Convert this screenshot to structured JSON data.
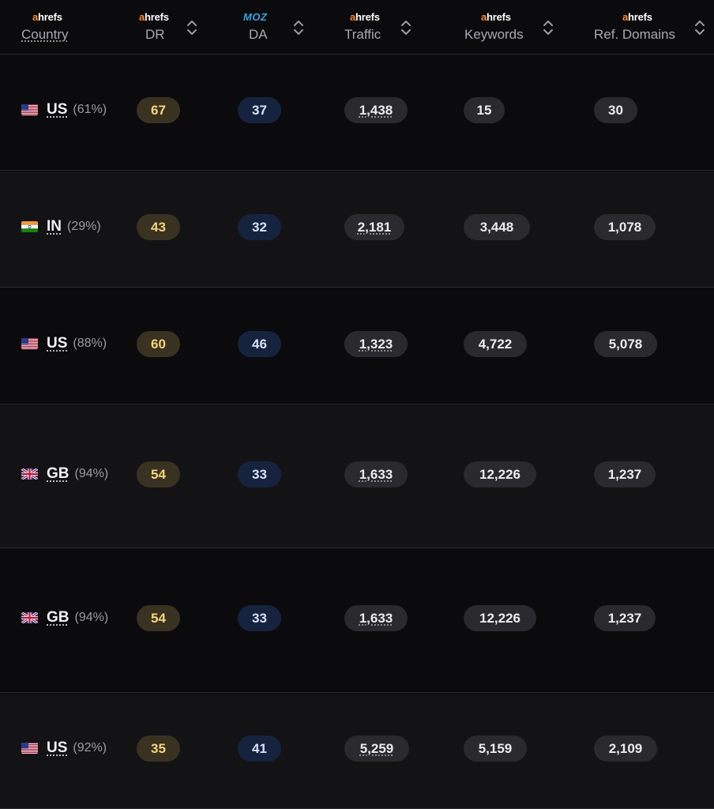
{
  "header": {
    "country": {
      "brand": "ahrefs",
      "label": "Country"
    },
    "dr": {
      "brand": "ahrefs",
      "label": "DR"
    },
    "da": {
      "brand": "MOZ",
      "label": "DA"
    },
    "traffic": {
      "brand": "ahrefs",
      "label": "Traffic"
    },
    "keywords": {
      "brand": "ahrefs",
      "label": "Keywords"
    },
    "ref_domains": {
      "brand": "ahrefs",
      "label": "Ref. Domains"
    }
  },
  "colors": {
    "ahrefs_accent": "#ff8a1f",
    "moz_blue": "#2aa7e0",
    "dr_pill": "#3a3220",
    "da_pill": "#16233f",
    "value_pill": "#2a2a2e"
  },
  "rows": [
    {
      "country": "US",
      "flag": "us-flag-icon",
      "pct": "(61%)",
      "dr": "67",
      "da": "37",
      "traffic": "1,438",
      "keywords": "15",
      "ref_domains": "30"
    },
    {
      "country": "IN",
      "flag": "in-flag-icon",
      "pct": "(29%)",
      "dr": "43",
      "da": "32",
      "traffic": "2,181",
      "keywords": "3,448",
      "ref_domains": "1,078"
    },
    {
      "country": "US",
      "flag": "us-flag-icon",
      "pct": "(88%)",
      "dr": "60",
      "da": "46",
      "traffic": "1,323",
      "keywords": "4,722",
      "ref_domains": "5,078"
    },
    {
      "country": "GB",
      "flag": "gb-flag-icon",
      "pct": "(94%)",
      "dr": "54",
      "da": "33",
      "traffic": "1,633",
      "keywords": "12,226",
      "ref_domains": "1,237"
    },
    {
      "country": "GB",
      "flag": "gb-flag-icon",
      "pct": "(94%)",
      "dr": "54",
      "da": "33",
      "traffic": "1,633",
      "keywords": "12,226",
      "ref_domains": "1,237"
    },
    {
      "country": "US",
      "flag": "us-flag-icon",
      "pct": "(92%)",
      "dr": "35",
      "da": "41",
      "traffic": "5,259",
      "keywords": "5,159",
      "ref_domains": "2,109"
    }
  ]
}
